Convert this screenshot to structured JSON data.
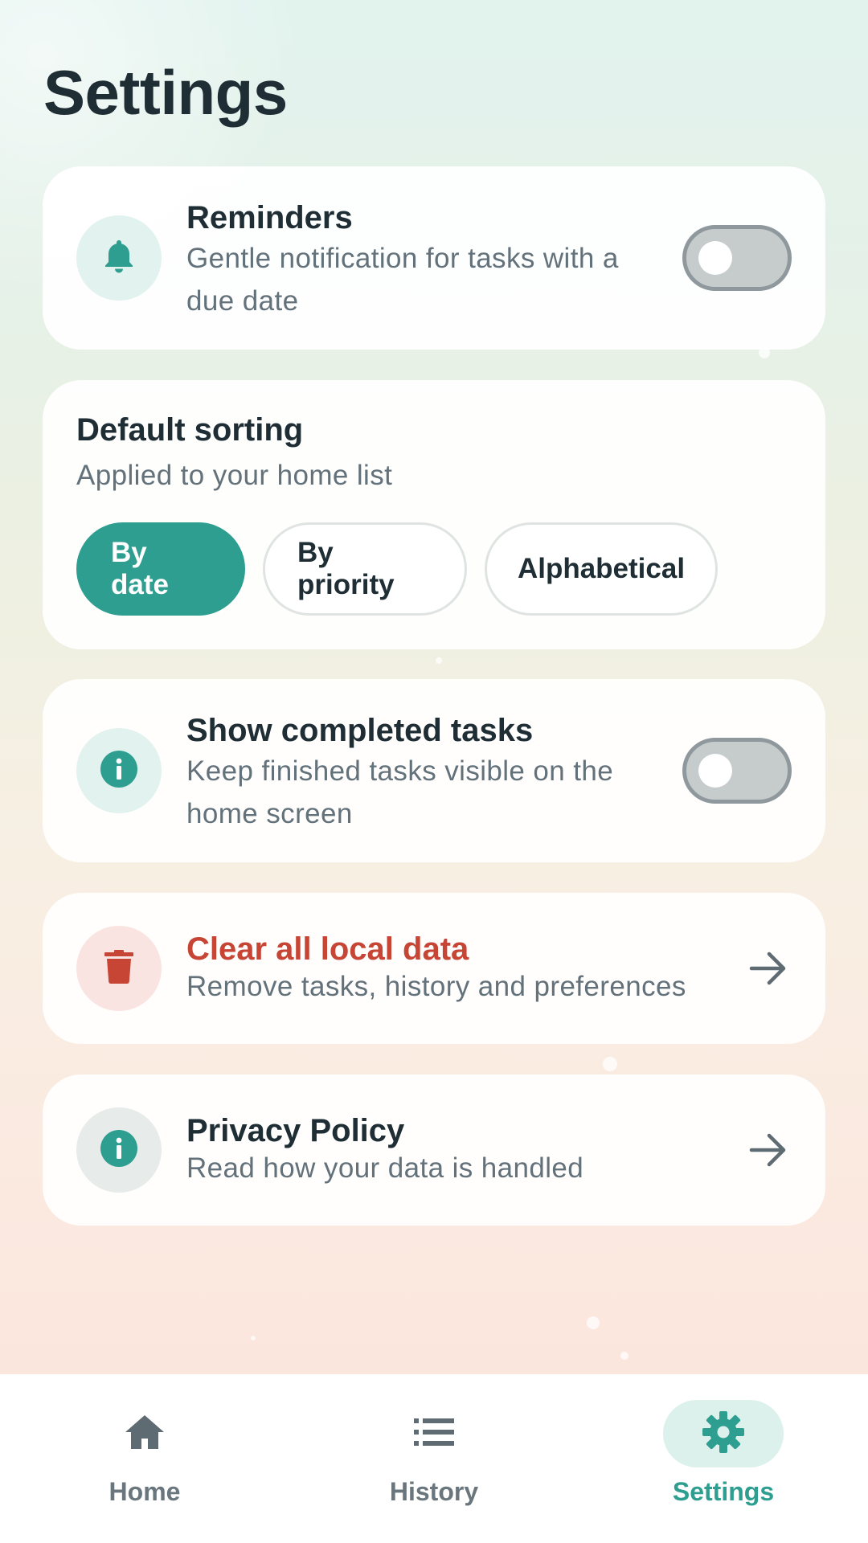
{
  "page": {
    "title": "Settings"
  },
  "reminders": {
    "title": "Reminders",
    "subtitle_line1": "Gentle notification for tasks with a",
    "subtitle_line2": "due date",
    "icon": "bell-icon",
    "enabled": false
  },
  "sorting": {
    "title": "Default sorting",
    "subtitle": "Applied to your home list",
    "options": [
      "By date",
      "By priority",
      "Alphabetical"
    ],
    "selected": "By date"
  },
  "completed": {
    "title": "Show completed tasks",
    "subtitle_line1": "Keep finished tasks visible on the",
    "subtitle_line2": "home screen",
    "icon": "info-icon",
    "enabled": false
  },
  "clear_data": {
    "title": "Clear all local data",
    "subtitle": "Remove tasks, history and preferences",
    "icon": "trash-icon"
  },
  "privacy": {
    "title": "Privacy Policy",
    "subtitle": "Read how your data is handled",
    "icon": "info-icon"
  },
  "nav": {
    "items": [
      {
        "label": "Home",
        "icon": "home-icon",
        "active": false
      },
      {
        "label": "History",
        "icon": "list-icon",
        "active": false
      },
      {
        "label": "Settings",
        "icon": "gear-icon",
        "active": true
      }
    ]
  },
  "colors": {
    "accent": "#2d9e8f",
    "danger": "#c64535",
    "text_primary": "#1f2d35",
    "text_secondary": "#62717a"
  }
}
